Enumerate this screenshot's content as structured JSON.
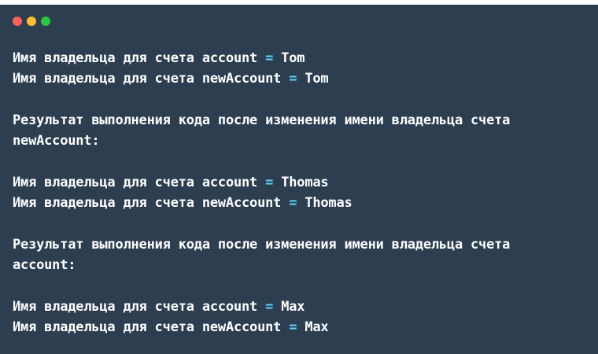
{
  "window": {
    "controls": [
      "close",
      "minimize",
      "maximize"
    ]
  },
  "lines": {
    "l1": {
      "prefix": "Имя владельца для счета account",
      "eq": "=",
      "value": "Tom"
    },
    "l2": {
      "prefix": "Имя владельца для счета newAccount",
      "eq": "=",
      "value": "Tom"
    },
    "p1a": "Результат выполнения кода после изменения имени владельца счета",
    "p1b": "newAccount:",
    "l3": {
      "prefix": "Имя владельца для счета account",
      "eq": "=",
      "value": "Thomas"
    },
    "l4": {
      "prefix": "Имя владельца для счета newAccount",
      "eq": "=",
      "value": "Thomas"
    },
    "p2a": "Результат выполнения кода после изменения имени владельца счета",
    "p2b": "account:",
    "l5": {
      "prefix": "Имя владельца для счета account",
      "eq": "=",
      "value": "Max"
    },
    "l6": {
      "prefix": "Имя владельца для счета newAccount",
      "eq": "=",
      "value": "Max"
    }
  },
  "colors": {
    "background": "#2c3e50",
    "text": "#ffffff",
    "operator": "#5fd3ff"
  }
}
